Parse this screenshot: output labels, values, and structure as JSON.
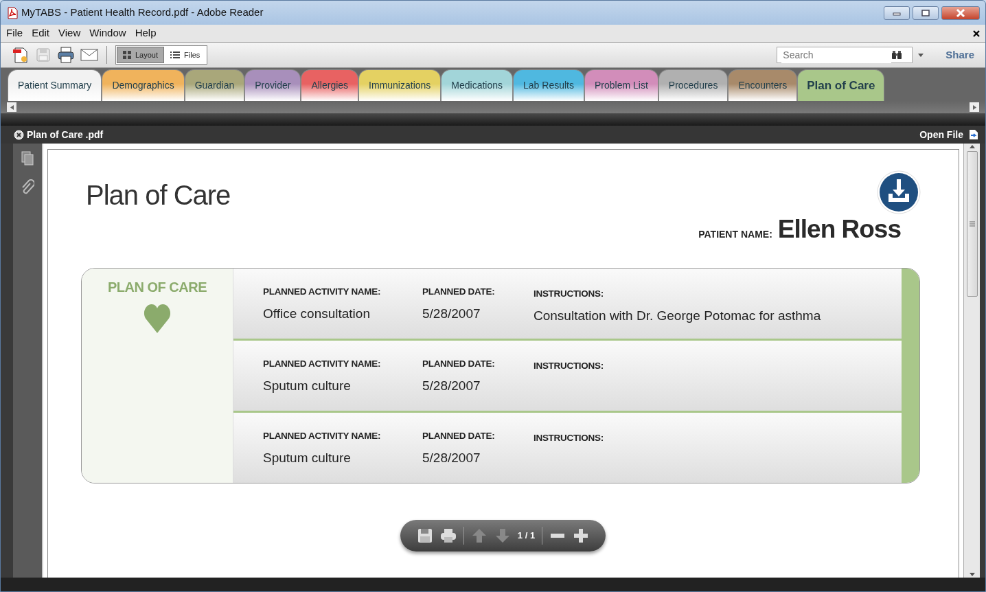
{
  "window": {
    "title": "MyTABS - Patient Health Record.pdf - Adobe Reader"
  },
  "menu": [
    "File",
    "Edit",
    "View",
    "Window",
    "Help"
  ],
  "toolbar": {
    "view_toggle": [
      {
        "label": "Layout",
        "selected": true
      },
      {
        "label": "Files",
        "selected": false
      }
    ],
    "search": {
      "placeholder": "Search"
    },
    "share": "Share"
  },
  "tabs": [
    {
      "label": "Patient Summary",
      "color": "#f2f2f2",
      "selected": false
    },
    {
      "label": "Demographics",
      "color": "#f0b35c",
      "selected": false
    },
    {
      "label": "Guardian",
      "color": "#a9a77a",
      "selected": false
    },
    {
      "label": "Provider",
      "color": "#a88fbb",
      "selected": false
    },
    {
      "label": "Allergies",
      "color": "#e86262",
      "selected": false
    },
    {
      "label": "Immunizations",
      "color": "#e4d162",
      "selected": false
    },
    {
      "label": "Medications",
      "color": "#a2d5d9",
      "selected": false
    },
    {
      "label": "Lab Results",
      "color": "#4fb8e0",
      "selected": false
    },
    {
      "label": "Problem List",
      "color": "#d28dba",
      "selected": false
    },
    {
      "label": "Procedures",
      "color": "#b0b0b0",
      "selected": false
    },
    {
      "label": "Encounters",
      "color": "#a88a6a",
      "selected": false
    },
    {
      "label": "Plan of Care",
      "color": "#a9c78a",
      "selected": true
    }
  ],
  "document": {
    "file_name": "Plan of Care .pdf",
    "open_file": "Open File",
    "title": "Plan of Care",
    "patient_label": "PATIENT NAME:",
    "patient_name": "Ellen Ross",
    "section_title": "PLAN OF CARE",
    "rows": [
      {
        "activity_label": "PLANNED ACTIVITY NAME:",
        "activity": "Office consultation",
        "date_label": "PLANNED DATE:",
        "date": "5/28/2007",
        "instructions_label": "INSTRUCTIONS:",
        "instructions": "Consultation with Dr. George Potomac for asthma"
      },
      {
        "activity_label": "PLANNED ACTIVITY NAME:",
        "activity": "Sputum culture",
        "date_label": "PLANNED DATE:",
        "date": "5/28/2007",
        "instructions_label": "INSTRUCTIONS:"
      },
      {
        "activity_label": "PLANNED ACTIVITY NAME:",
        "activity": "Sputum culture",
        "date_label": "PLANNED DATE:",
        "date": "5/28/2007",
        "instructions_label": "INSTRUCTIONS:"
      }
    ],
    "page_indicator": "1 / 1"
  }
}
